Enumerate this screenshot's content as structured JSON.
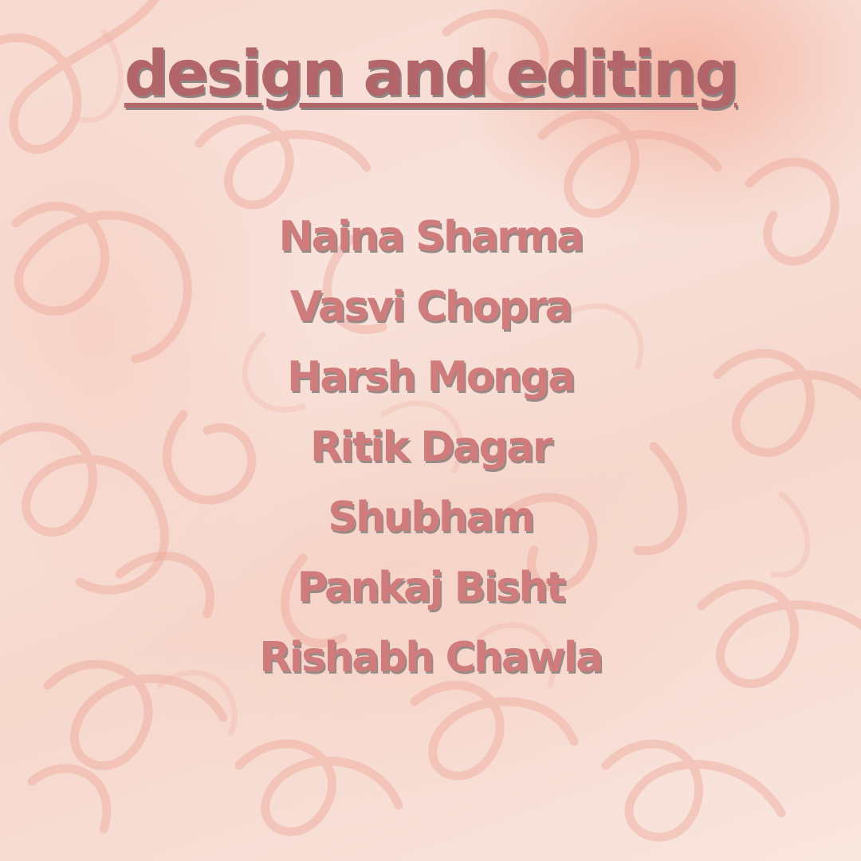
{
  "title": "design and editing",
  "names": [
    "Naina Sharma",
    "Vasvi Chopra",
    "Harsh Monga",
    "Ritik Dagar",
    "Shubham",
    "Pankaj Bisht",
    "Rishabh Chawla"
  ],
  "colors": {
    "title": "#b2666a",
    "names": "#d17c7c",
    "background": "#f7ddd4",
    "doodle": "#eea79a"
  }
}
